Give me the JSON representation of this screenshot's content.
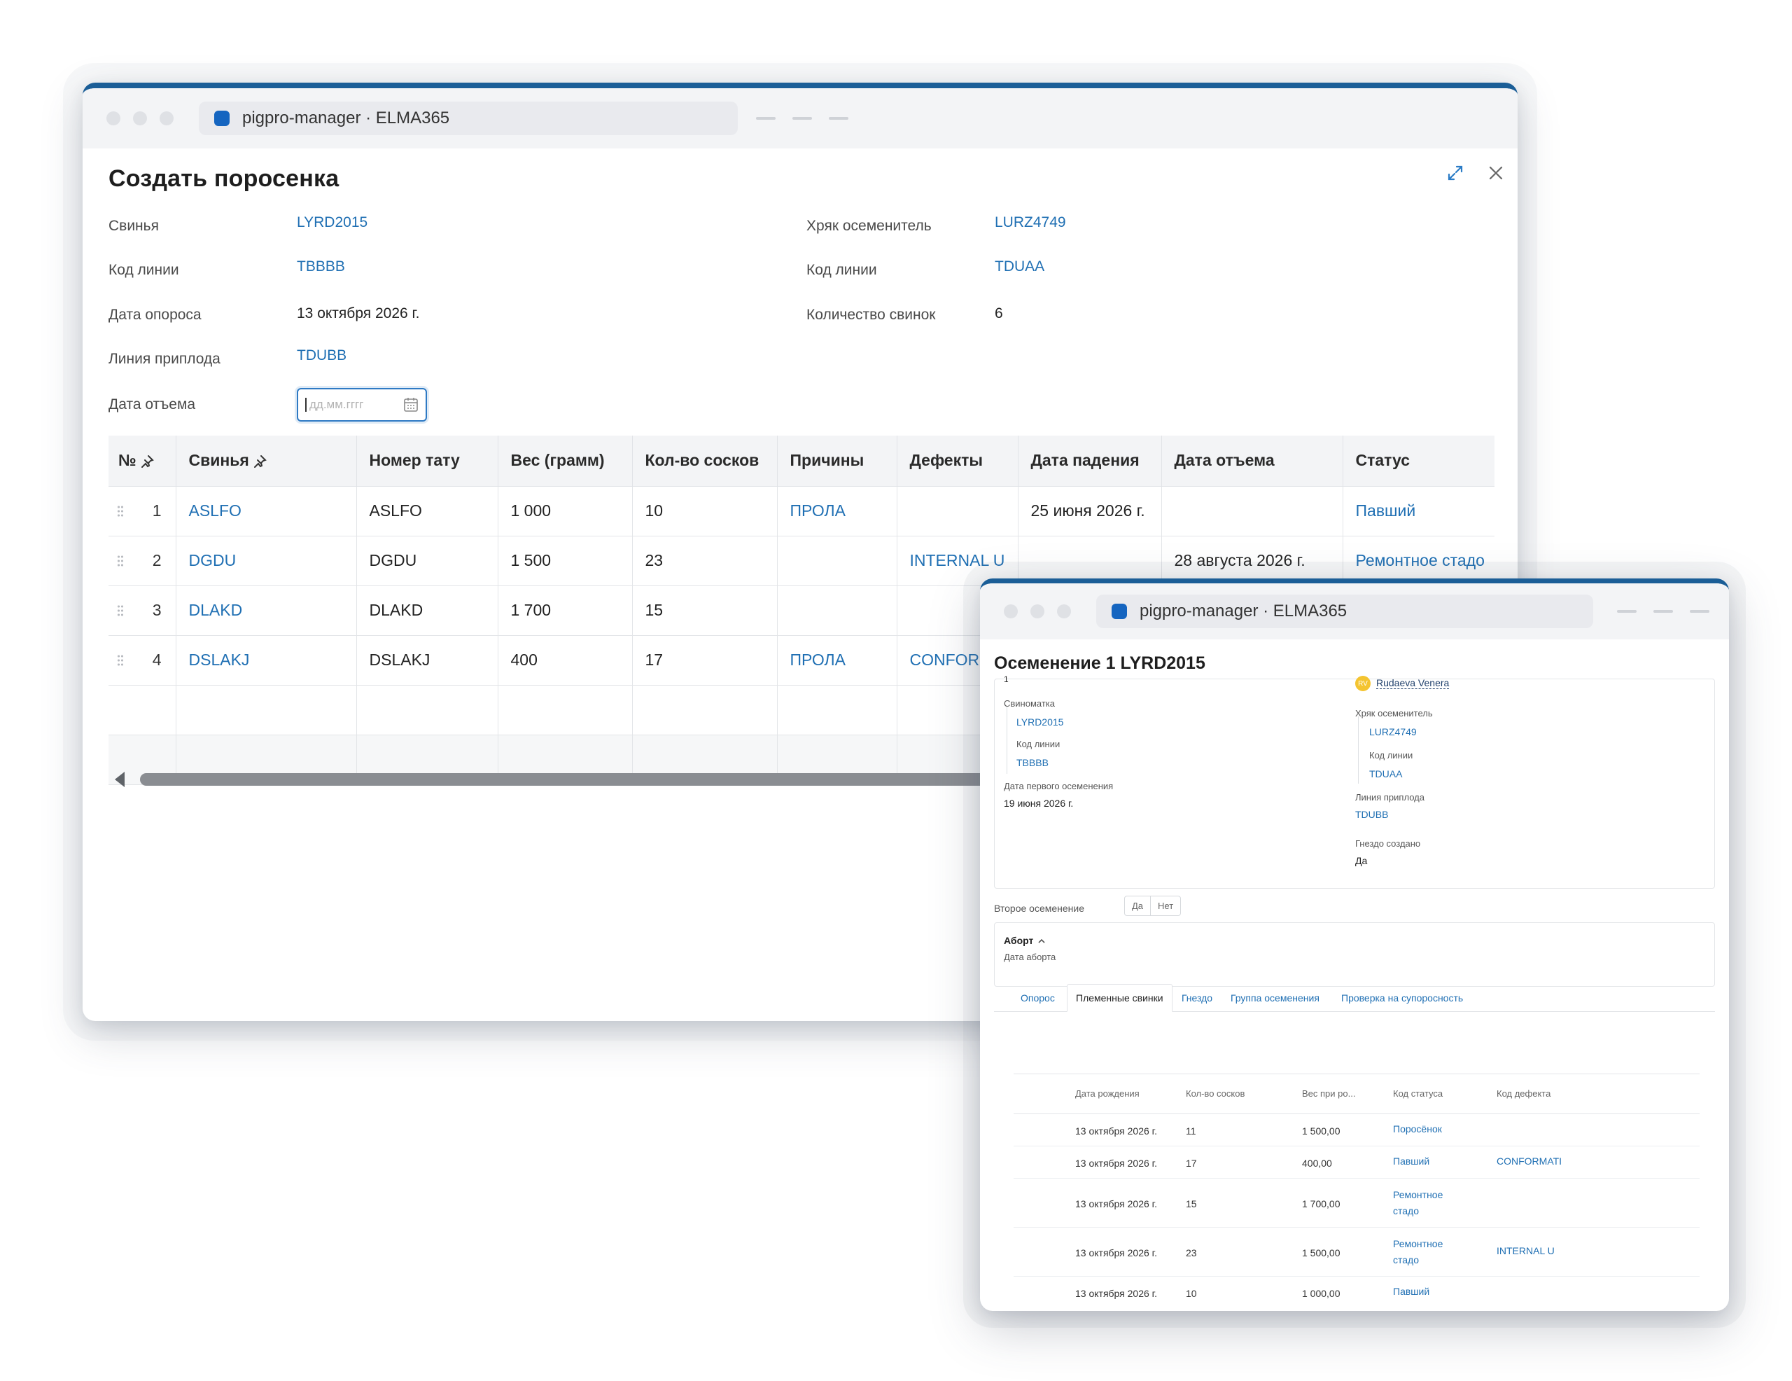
{
  "window1": {
    "tab_title": "pigpro-manager · ELMA365",
    "modal_title": "Создать поросенка",
    "fields_left": [
      {
        "label": "Свинья",
        "value": "LYRD2015"
      },
      {
        "label": "Код линии",
        "value": "TBBBB"
      },
      {
        "label": "Дата опороса",
        "value": "13 октября 2026 г."
      },
      {
        "label": "Линия приплода",
        "value": "TDUBB"
      },
      {
        "label": "Дата отъема",
        "value": ""
      }
    ],
    "fields_right": [
      {
        "label": "Хряк осеменитель",
        "value": "LURZ4749"
      },
      {
        "label": "Код линии",
        "value": "TDUAA"
      },
      {
        "label": "Количество свинок",
        "value": "6"
      }
    ],
    "date_placeholder": "дд.мм.гггг",
    "table": {
      "headers": [
        "№",
        "Свинья",
        "Номер тату",
        "Вес (грамм)",
        "Кол-во сосков",
        "Причины",
        "Дефекты",
        "Дата падения",
        "Дата отъема",
        "Статус"
      ],
      "rows": [
        {
          "n": "1",
          "pig": "ASLFO",
          "tattoo": "ASLFO",
          "weight": "1 000",
          "teats": "10",
          "reasons": "ПРОЛА",
          "defects": "",
          "death": "25 июня 2026 г.",
          "wean": "",
          "status": "Павший"
        },
        {
          "n": "2",
          "pig": "DGDU",
          "tattoo": "DGDU",
          "weight": "1 500",
          "teats": "23",
          "reasons": "",
          "defects": "INTERNAL U",
          "death": "",
          "wean": "28 августа 2026 г.",
          "status": "Ремонтное стадо"
        },
        {
          "n": "3",
          "pig": "DLAKD",
          "tattoo": "DLAKD",
          "weight": "1 700",
          "teats": "15",
          "reasons": "",
          "defects": "",
          "death": "",
          "wean": "",
          "status": ""
        },
        {
          "n": "4",
          "pig": "DSLAKJ",
          "tattoo": "DSLAKJ",
          "weight": "400",
          "teats": "17",
          "reasons": "ПРОЛА",
          "defects": "CONFORM",
          "death": "",
          "wean": "",
          "status": ""
        }
      ]
    }
  },
  "window2": {
    "tab_title": "pigpro-manager · ELMA365",
    "page_title": "Осеменение 1 LYRD2015",
    "number": "1",
    "user": {
      "initials": "RV",
      "name": "Rudaeva Venera"
    },
    "left": {
      "sow_label": "Свиноматка",
      "sow_value": "LYRD2015",
      "line_label": "Код линии",
      "line_value": "TBBBB",
      "first_label": "Дата первого осеменения",
      "first_value": "19 июня 2026 г."
    },
    "right": {
      "boar_label": "Хряк осеменитель",
      "boar_value": "LURZ4749",
      "line_label": "Код линии",
      "line_value": "TDUAA",
      "offspring_label": "Линия приплода",
      "offspring_value": "TDUBB",
      "nest_label": "Гнездо создано",
      "nest_value": "Да"
    },
    "second": {
      "label": "Второе осеменение",
      "yes": "Да",
      "no": "Нет"
    },
    "abortion": {
      "title": "Аборт",
      "date_label": "Дата аборта"
    },
    "tabs": [
      "Опорос",
      "Племенные свинки",
      "Гнездо",
      "Группа осеменения",
      "Проверка на супоросность"
    ],
    "sub_headers": [
      "Дата рождения",
      "Кол-во сосков",
      "Вес при ро...",
      "Код статуса",
      "Код дефекта"
    ],
    "sub_rows": [
      {
        "date": "13 октября 2026 г.",
        "teats": "11",
        "weight": "1 500,00",
        "status": "Поросёнок",
        "defect": ""
      },
      {
        "date": "13 октября 2026 г.",
        "teats": "17",
        "weight": "400,00",
        "status": "Павший",
        "defect": "CONFORMATI"
      },
      {
        "date": "13 октября 2026 г.",
        "teats": "15",
        "weight": "1 700,00",
        "status": "Ремонтное стадо",
        "defect": ""
      },
      {
        "date": "13 октября 2026 г.",
        "teats": "23",
        "weight": "1 500,00",
        "status": "Ремонтное стадо",
        "defect": "INTERNAL U"
      },
      {
        "date": "13 октября 2026 г.",
        "teats": "10",
        "weight": "1 000,00",
        "status": "Павший",
        "defect": ""
      }
    ]
  },
  "colors": {
    "accent": "#1b5e97",
    "link": "#1f6fb3",
    "header_bg": "#f3f4f6"
  }
}
